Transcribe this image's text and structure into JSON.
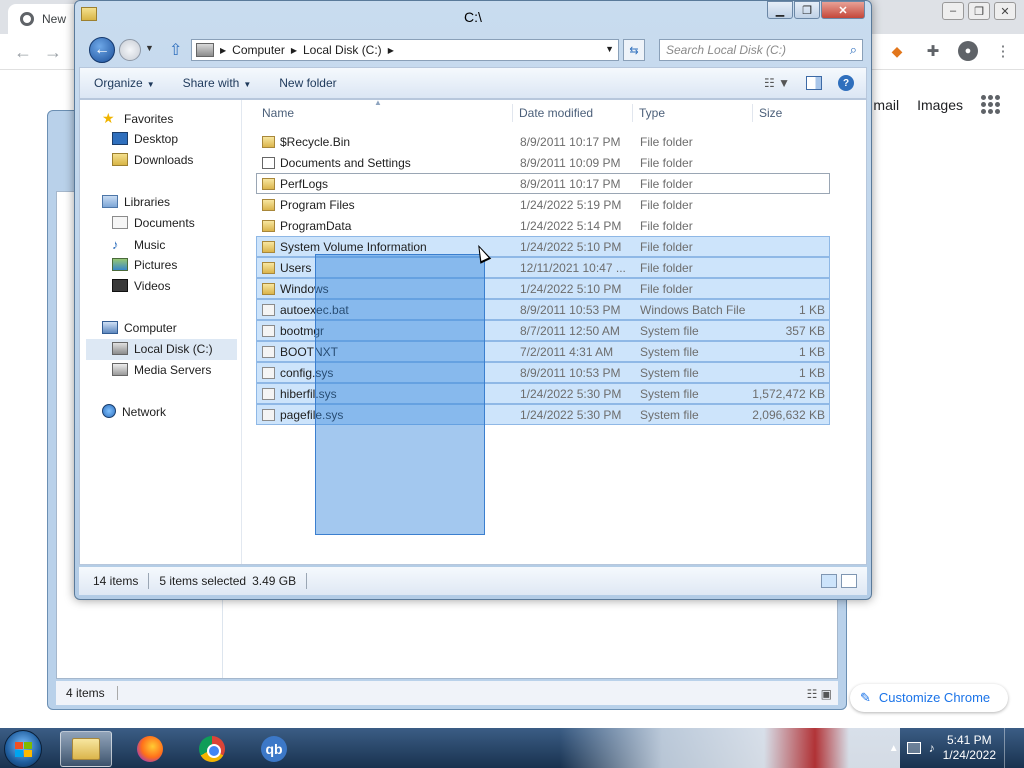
{
  "chrome": {
    "tab_title": "New",
    "links": [
      "mail",
      "Images"
    ],
    "customize_label": "Customize Chrome"
  },
  "bg_window": {
    "status_items": "4 items"
  },
  "window": {
    "title": "C:\\",
    "address": {
      "crumbs": [
        "Computer",
        "Local Disk (C:)"
      ]
    },
    "search_placeholder": "Search Local Disk (C:)",
    "commands": {
      "organize": "Organize",
      "share_with": "Share with",
      "new_folder": "New folder"
    },
    "nav": {
      "favorites": "Favorites",
      "favorites_items": [
        "Desktop",
        "Downloads"
      ],
      "libraries": "Libraries",
      "libraries_items": [
        "Documents",
        "Music",
        "Pictures",
        "Videos"
      ],
      "computer": "Computer",
      "computer_items": [
        "Local Disk (C:)",
        "Media Servers"
      ],
      "network": "Network"
    },
    "columns": {
      "name": "Name",
      "date": "Date modified",
      "type": "Type",
      "size": "Size"
    },
    "files": [
      {
        "name": "$Recycle.Bin",
        "date": "8/9/2011 10:17 PM",
        "type": "File folder",
        "size": ""
      },
      {
        "name": "Documents and Settings",
        "date": "8/9/2011 10:09 PM",
        "type": "File folder",
        "size": ""
      },
      {
        "name": "PerfLogs",
        "date": "8/9/2011 10:17 PM",
        "type": "File folder",
        "size": ""
      },
      {
        "name": "Program Files",
        "date": "1/24/2022 5:19 PM",
        "type": "File folder",
        "size": ""
      },
      {
        "name": "ProgramData",
        "date": "1/24/2022 5:14 PM",
        "type": "File folder",
        "size": ""
      },
      {
        "name": "System Volume Information",
        "date": "1/24/2022 5:10 PM",
        "type": "File folder",
        "size": ""
      },
      {
        "name": "Users",
        "date": "12/11/2021 10:47 ...",
        "type": "File folder",
        "size": ""
      },
      {
        "name": "Windows",
        "date": "1/24/2022 5:10 PM",
        "type": "File folder",
        "size": ""
      },
      {
        "name": "autoexec.bat",
        "date": "8/9/2011 10:53 PM",
        "type": "Windows Batch File",
        "size": "1 KB"
      },
      {
        "name": "bootmgr",
        "date": "8/7/2011 12:50 AM",
        "type": "System file",
        "size": "357 KB"
      },
      {
        "name": "BOOTNXT",
        "date": "7/2/2011 4:31 AM",
        "type": "System file",
        "size": "1 KB"
      },
      {
        "name": "config.sys",
        "date": "8/9/2011 10:53 PM",
        "type": "System file",
        "size": "1 KB"
      },
      {
        "name": "hiberfil.sys",
        "date": "1/24/2022 5:30 PM",
        "type": "System file",
        "size": "1,572,472 KB"
      },
      {
        "name": "pagefile.sys",
        "date": "1/24/2022 5:30 PM",
        "type": "System file",
        "size": "2,096,632 KB"
      }
    ],
    "status": {
      "items": "14 items",
      "selected": "5 items selected",
      "size": "3.49 GB"
    }
  },
  "taskbar": {
    "qb_label": "qb",
    "time": "5:41 PM",
    "date": "1/24/2022"
  }
}
